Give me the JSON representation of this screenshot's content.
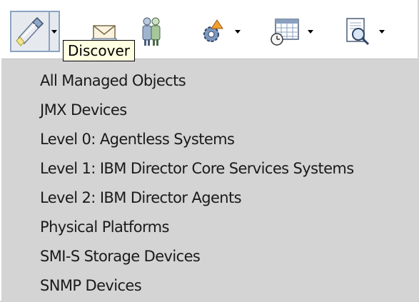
{
  "toolbar": {
    "buttons": [
      {
        "name": "discover",
        "icon": "flashlight-icon",
        "has_dropdown": true,
        "pressed": true
      },
      {
        "name": "mail",
        "icon": "envelope-icon",
        "has_dropdown": false,
        "pressed": false
      },
      {
        "name": "users",
        "icon": "people-icon",
        "has_dropdown": false,
        "pressed": false
      },
      {
        "name": "tasks",
        "icon": "gear-icon",
        "has_dropdown": true,
        "pressed": false
      },
      {
        "name": "scheduler",
        "icon": "calendar-clock-icon",
        "has_dropdown": true,
        "pressed": false
      },
      {
        "name": "inventory",
        "icon": "magnifier-document-icon",
        "has_dropdown": true,
        "pressed": false
      }
    ]
  },
  "tooltip": {
    "text": "Discover"
  },
  "menu": {
    "items": [
      {
        "label": "All Managed Objects"
      },
      {
        "label": "JMX Devices"
      },
      {
        "label": "Level 0: Agentless Systems"
      },
      {
        "label": "Level 1: IBM Director Core Services Systems"
      },
      {
        "label": "Level 2: IBM Director Agents"
      },
      {
        "label": "Physical Platforms"
      },
      {
        "label": "SMI-S Storage Devices"
      },
      {
        "label": "SNMP Devices"
      }
    ]
  },
  "colors": {
    "menu_bg": "#d4d4d4",
    "tooltip_bg": "#ffffe1",
    "pressed_border": "#8ba3c2"
  }
}
